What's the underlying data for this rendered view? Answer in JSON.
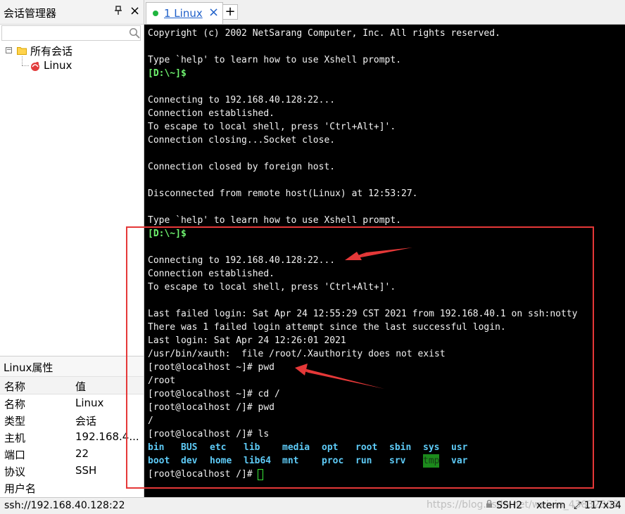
{
  "session_manager": {
    "title": "会话管理器",
    "pin_icon": "pin-icon",
    "close_label": "×",
    "search": {
      "value": "",
      "placeholder": ""
    },
    "tree": {
      "expander": "−",
      "root_label": "所有会话",
      "items": [
        {
          "label": "Linux"
        }
      ]
    }
  },
  "properties": {
    "title": "Linux属性",
    "columns": [
      "名称",
      "值"
    ],
    "rows": [
      {
        "name": "名称",
        "value": "Linux"
      },
      {
        "name": "类型",
        "value": "会话"
      },
      {
        "name": "主机",
        "value": "192.168.4..."
      },
      {
        "name": "端口",
        "value": "22"
      },
      {
        "name": "协议",
        "value": "SSH"
      },
      {
        "name": "用户名",
        "value": ""
      }
    ]
  },
  "tabs": {
    "items": [
      {
        "label": "1 Linux",
        "close": "×"
      }
    ],
    "new_tab": "+",
    "status_color": "#1fb53f"
  },
  "terminal": {
    "lines": [
      "Copyright (c) 2002 NetSarang Computer, Inc. All rights reserved.",
      "",
      "Type `help' to learn how to use Xshell prompt.",
      "[D:\\~]$",
      "",
      "Connecting to 192.168.40.128:22...",
      "Connection established.",
      "To escape to local shell, press 'Ctrl+Alt+]'.",
      "Connection closing...Socket close.",
      "",
      "Connection closed by foreign host.",
      "",
      "Disconnected from remote host(Linux) at 12:53:27.",
      "",
      "Type `help' to learn how to use Xshell prompt.",
      "[D:\\~]$",
      "",
      "Connecting to 192.168.40.128:22...",
      "Connection established.",
      "To escape to local shell, press 'Ctrl+Alt+]'.",
      "",
      "Last failed login: Sat Apr 24 12:55:29 CST 2021 from 192.168.40.1 on ssh:notty",
      "There was 1 failed login attempt since the last successful login.",
      "Last login: Sat Apr 24 12:26:01 2021",
      "/usr/bin/xauth:  file /root/.Xauthority does not exist",
      "[root@localhost ~]# pwd",
      "/root",
      "[root@localhost ~]# cd /",
      "[root@localhost /]# pwd",
      "/",
      "[root@localhost /]# ls"
    ],
    "ls_rows": [
      [
        "bin",
        "BUS",
        "etc",
        "lib",
        "media",
        "opt",
        "root",
        "sbin",
        "sys",
        "usr"
      ],
      [
        "boot",
        "dev",
        "home",
        "lib64",
        "mnt",
        "proc",
        "run",
        "srv",
        "tmp",
        "var"
      ]
    ],
    "final_prompt": "[root@localhost /]# ",
    "colors": {
      "background": "#000000",
      "text": "#f2f2f2",
      "prompt": "#6ff36f",
      "directory": "#5ecbf7",
      "annotation": "#e53838"
    }
  },
  "statusbar": {
    "address": "ssh://192.168.40.128:22",
    "watermark": "https://blog.csdn.net/weixin_43832308",
    "protocol": "SSH2",
    "term_type": "xterm",
    "size": "117x34"
  }
}
